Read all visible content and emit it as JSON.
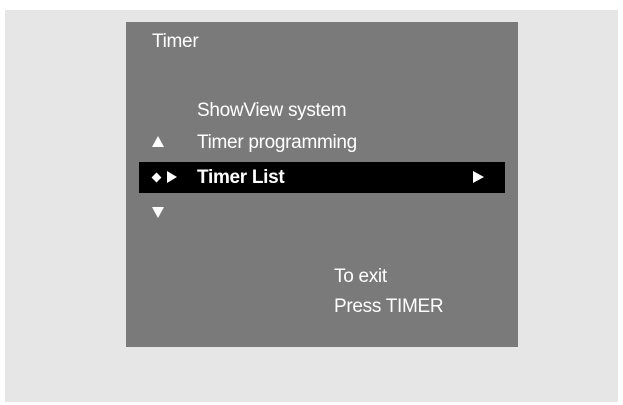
{
  "screen": {
    "title": "Timer",
    "menu": {
      "items": [
        {
          "label": "ShowView system"
        },
        {
          "label": "Timer programming"
        },
        {
          "label": "Timer List",
          "selected": true
        }
      ]
    },
    "help": {
      "line1": "To exit",
      "line2": "Press TIMER"
    },
    "icons": {
      "scroll_up": "triangle-up-icon",
      "scroll_down": "triangle-down-icon",
      "selector": "diamond-arrow-icon",
      "submenu": "triangle-right-icon"
    },
    "colors": {
      "outer_background": "#e6e6e6",
      "osd_background": "#7a7a7a",
      "highlight": "#000000",
      "text": "#ffffff"
    }
  }
}
